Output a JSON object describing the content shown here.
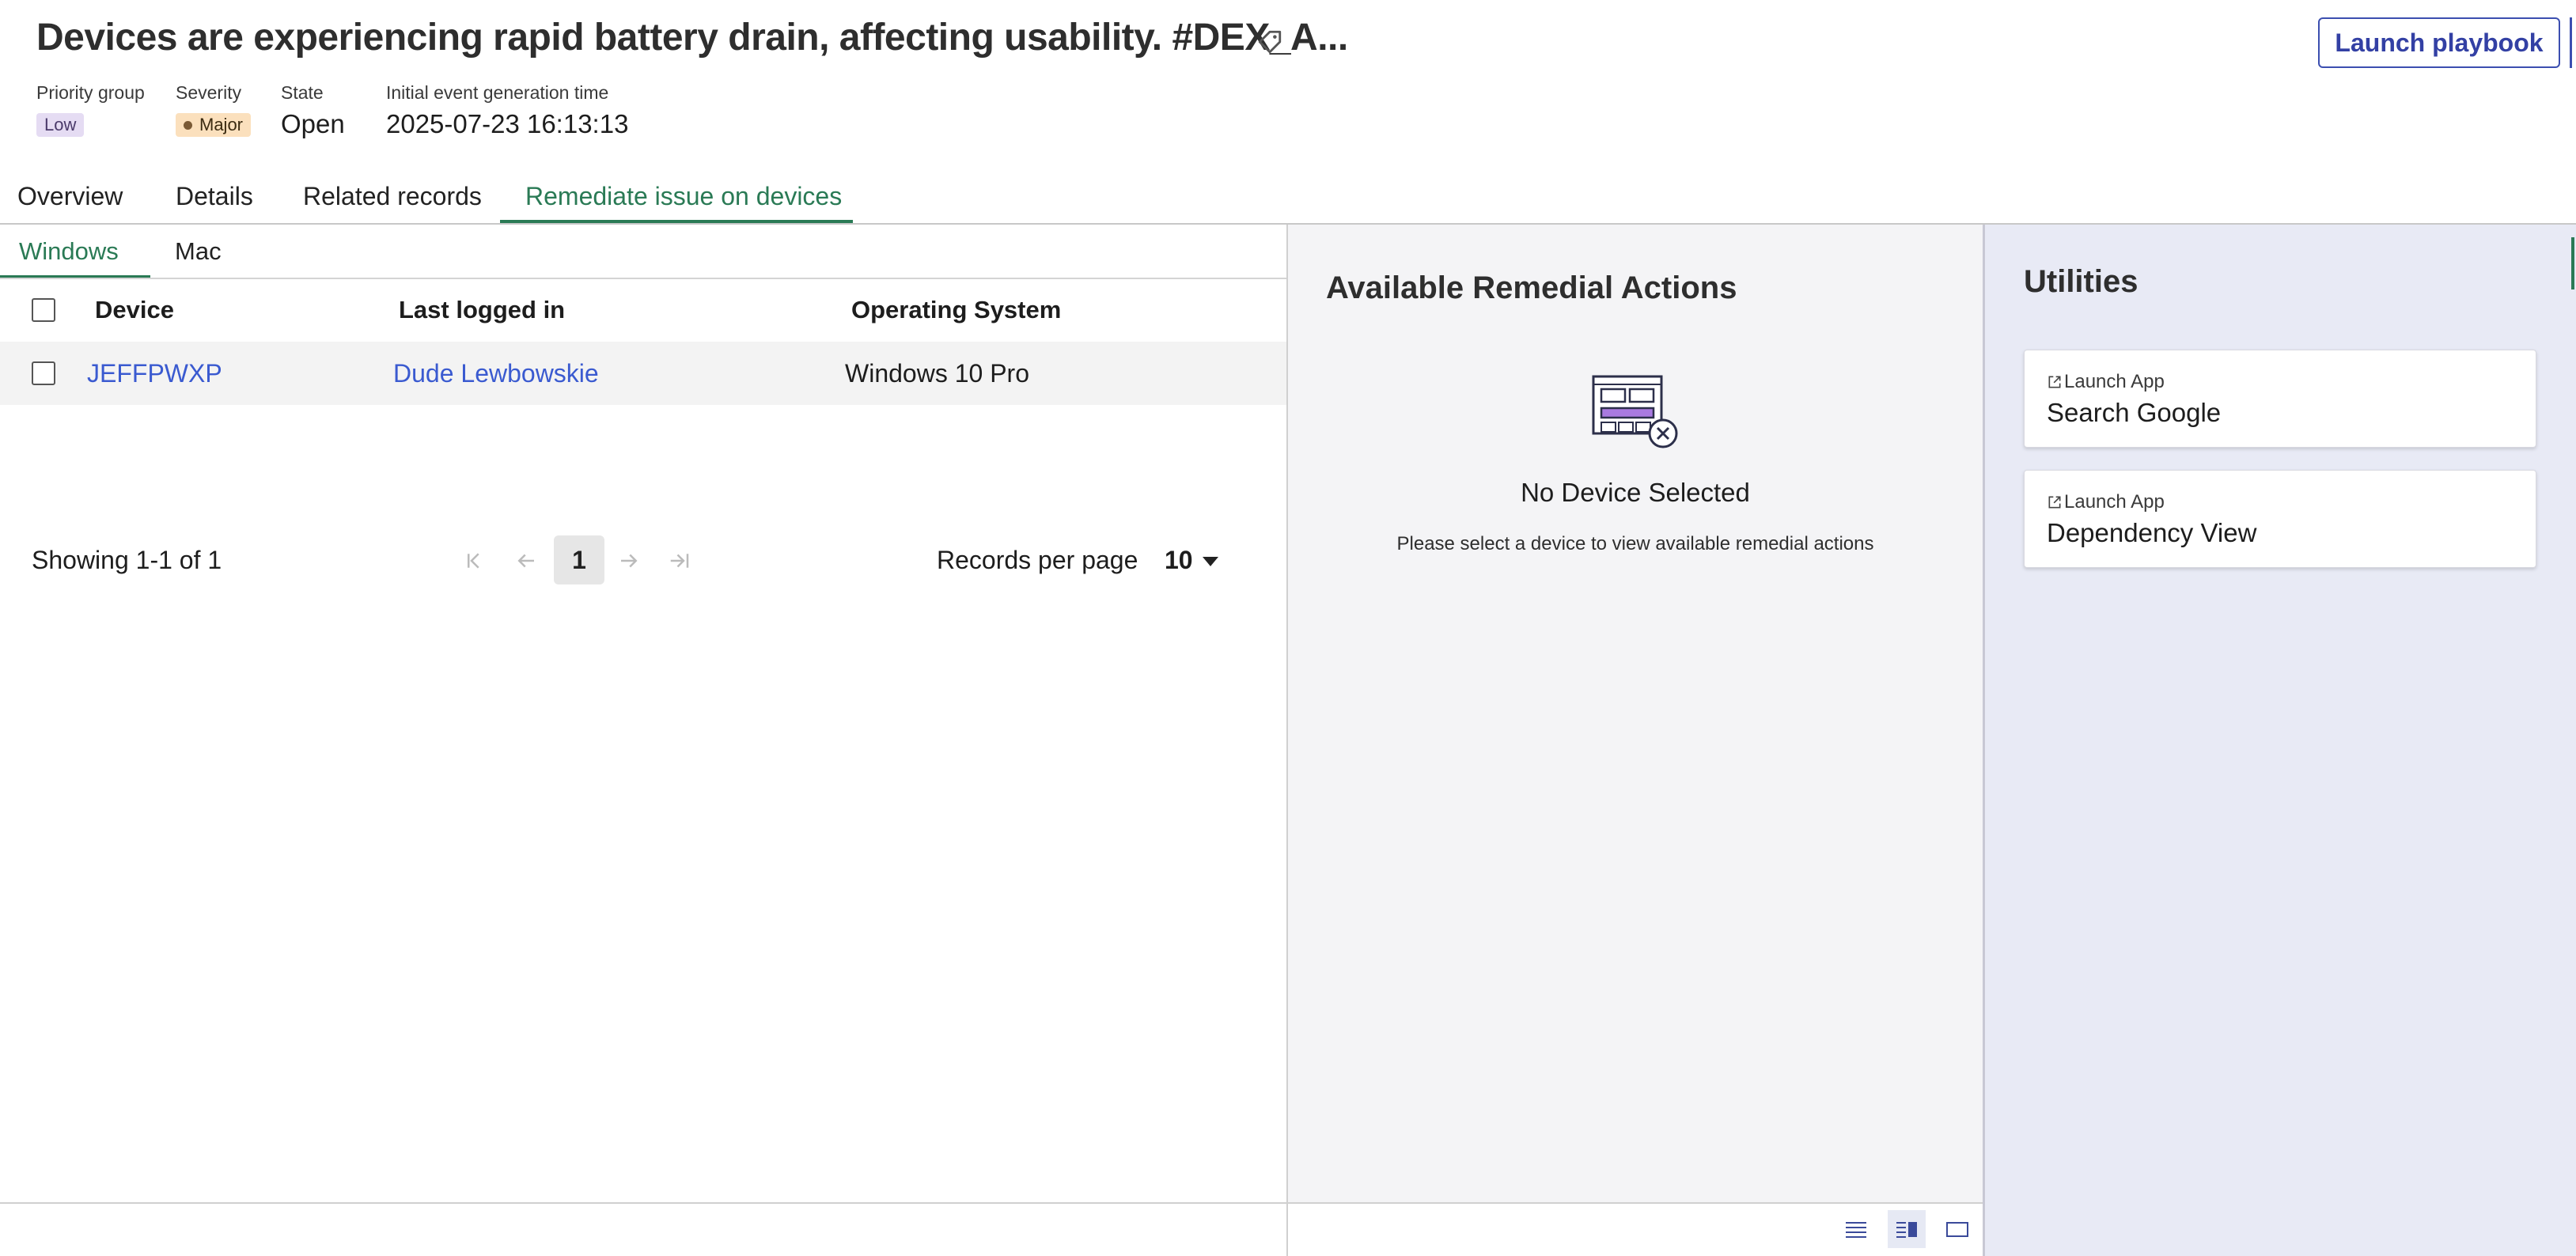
{
  "header": {
    "title": "Devices are experiencing rapid battery drain, affecting usability. #DEX_A...",
    "launch_playbook_label": "Launch playbook",
    "fields": {
      "priority_group_label": "Priority group",
      "priority_group_value": "Low",
      "severity_label": "Severity",
      "severity_value": "Major",
      "state_label": "State",
      "state_value": "Open",
      "event_time_label": "Initial event generation time",
      "event_time_value": "2025-07-23 16:13:13"
    }
  },
  "tabs": [
    {
      "label": "Overview"
    },
    {
      "label": "Details"
    },
    {
      "label": "Related records"
    },
    {
      "label": "Remediate issue on devices",
      "active": true
    }
  ],
  "os_tabs": [
    {
      "label": "Windows",
      "active": true
    },
    {
      "label": "Mac"
    }
  ],
  "table": {
    "columns": [
      "Device",
      "Last logged in",
      "Operating System"
    ],
    "rows": [
      {
        "device": "JEFFPWXP",
        "last_logged_in": "Dude Lewbowskie",
        "os": "Windows 10 Pro"
      }
    ]
  },
  "pagination": {
    "showing": "Showing 1-1 of 1",
    "current_page": "1",
    "records_per_page_label": "Records per page",
    "records_per_page_value": "10"
  },
  "remedial": {
    "title": "Available Remedial Actions",
    "empty_title": "No Device Selected",
    "empty_desc": "Please select a device to view available remedial actions"
  },
  "utilities": {
    "title": "Utilities",
    "items": [
      {
        "kicker": "Launch App",
        "name": "Search Google"
      },
      {
        "kicker": "Launch App",
        "name": "Dependency View"
      }
    ]
  },
  "colors": {
    "accent_green": "#2a7a55",
    "link_blue": "#3a5ad0",
    "button_blue": "#3340a4",
    "low_badge": "#e5dcf3",
    "major_badge": "#fbe0bd"
  },
  "icons": [
    "tag-icon",
    "first-page-icon",
    "prev-page-icon",
    "next-page-icon",
    "last-page-icon",
    "dropdown-caret-icon",
    "empty-state-illustration",
    "external-link-icon",
    "list-view-icon",
    "split-view-icon",
    "full-view-icon"
  ]
}
